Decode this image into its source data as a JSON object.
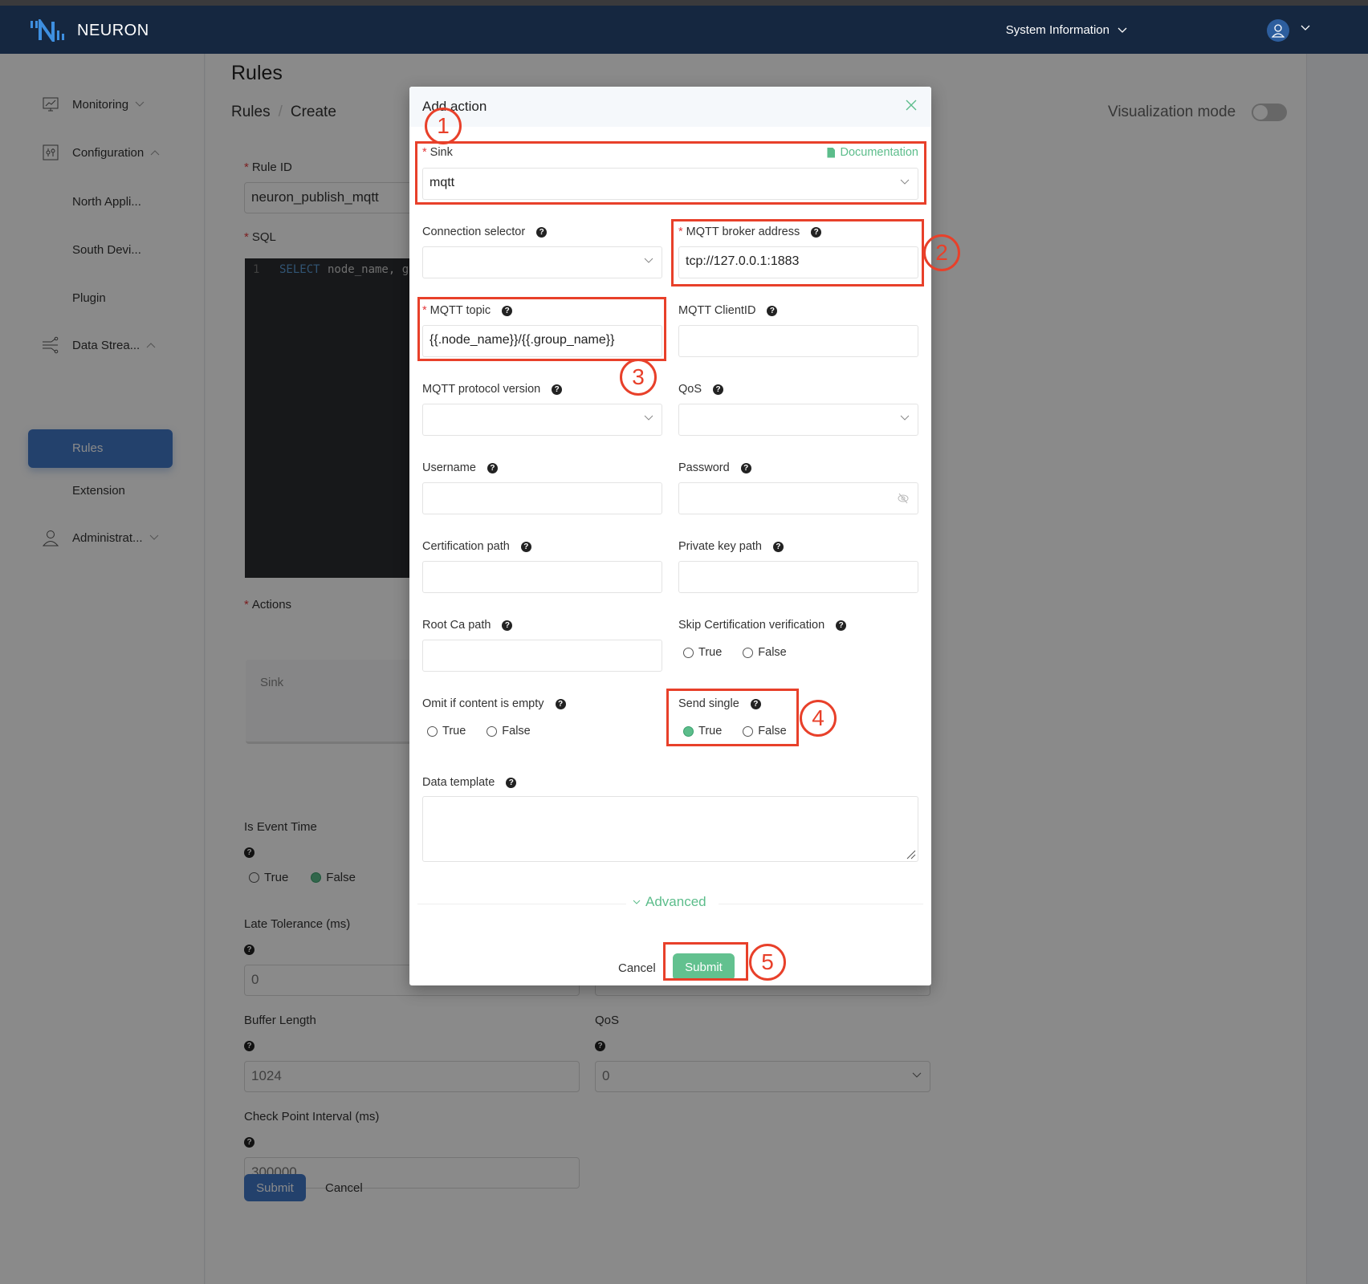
{
  "app": {
    "name": "NEURON"
  },
  "header": {
    "system_info_label": "System Information",
    "user_icon": "user-icon"
  },
  "sidebar": {
    "items": [
      {
        "label": "Monitoring",
        "icon": "monitor-chart-icon",
        "expanded": false
      },
      {
        "label": "Configuration",
        "icon": "sliders-icon",
        "expanded": true,
        "children": [
          "North Appli...",
          "South Devi...",
          "Plugin"
        ]
      },
      {
        "label": "Data Strea...",
        "icon": "data-stream-icon",
        "expanded": true,
        "children": [
          "Rules",
          "Extension"
        ]
      },
      {
        "label": "Administrat...",
        "icon": "user-icon",
        "expanded": false
      }
    ],
    "active": "Rules"
  },
  "page": {
    "title": "Rules",
    "breadcrumb": [
      "Rules",
      "Create"
    ],
    "visualization_mode_label": "Visualization mode",
    "visualization_mode_on": false,
    "rule_id_label": "Rule ID",
    "rule_id_value": "neuron_publish_mqtt",
    "sql_label": "SQL",
    "sql_line_number": "1",
    "sql_keyword": "SELECT",
    "sql_rest": "node_name, g",
    "actions_label": "Actions",
    "actions_sink_col": "Sink",
    "is_event_time_label": "Is Event Time",
    "is_event_time_options": [
      "True",
      "False"
    ],
    "is_event_time_selected": "False",
    "late_tolerance_label": "Late Tolerance (ms)",
    "late_tolerance_value": "0",
    "buffer_length_label": "Buffer Length",
    "buffer_length_value": "1024",
    "qos_label": "QoS",
    "qos_value": "0",
    "checkpoint_label": "Check Point Interval (ms)",
    "checkpoint_value": "300000",
    "submit_label": "Submit",
    "cancel_label": "Cancel"
  },
  "modal": {
    "title": "Add action",
    "documentation_label": "Documentation",
    "sink_label": "Sink",
    "sink_value": "mqtt",
    "connection_selector_label": "Connection selector",
    "connection_selector_value": "",
    "broker_label": "MQTT broker address",
    "broker_value": "tcp://127.0.0.1:1883",
    "topic_label": "MQTT topic",
    "topic_value": "{{.node_name}}/{{.group_name}}",
    "clientid_label": "MQTT ClientID",
    "clientid_value": "",
    "protocol_label": "MQTT protocol version",
    "protocol_value": "",
    "qos_label": "QoS",
    "qos_value": "",
    "username_label": "Username",
    "username_value": "",
    "password_label": "Password",
    "password_value": "",
    "cert_label": "Certification path",
    "cert_value": "",
    "privkey_label": "Private key path",
    "privkey_value": "",
    "rootca_label": "Root Ca path",
    "rootca_value": "",
    "skipcert_label": "Skip Certification verification",
    "skipcert_options": [
      "True",
      "False"
    ],
    "skipcert_selected": null,
    "omit_label": "Omit if content is empty",
    "omit_options": [
      "True",
      "False"
    ],
    "omit_selected": null,
    "sendsingle_label": "Send single",
    "sendsingle_options": [
      "True",
      "False"
    ],
    "sendsingle_selected": "True",
    "datatemplate_label": "Data template",
    "datatemplate_value": "",
    "advanced_label": "Advanced",
    "cancel_label": "Cancel",
    "submit_label": "Submit"
  },
  "annotations": [
    "1",
    "2",
    "3",
    "4",
    "5"
  ],
  "colors": {
    "header_bg": "#152740",
    "primary_blue": "#4279c8",
    "accent_green": "#5cbd8b",
    "annotation_red": "#e8402a"
  }
}
